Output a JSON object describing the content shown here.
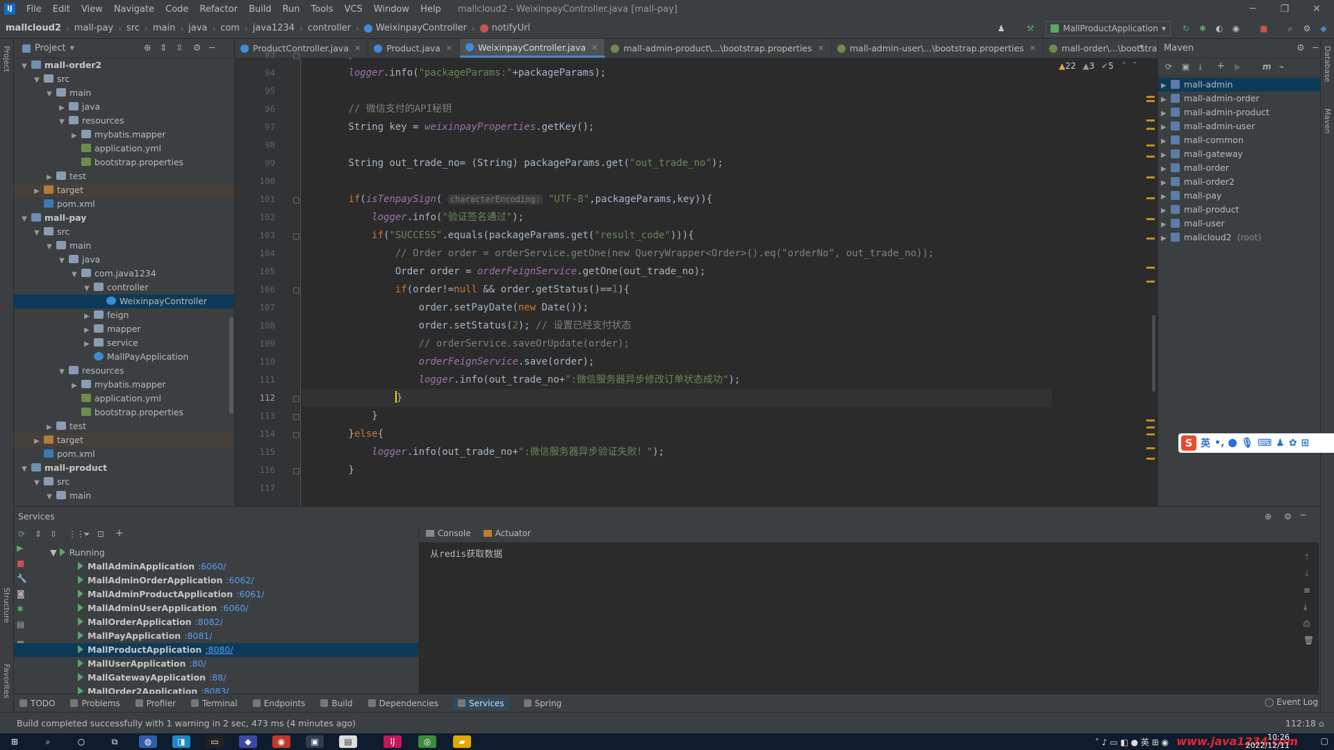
{
  "window": {
    "title": "mallcloud2 - WeixinpayController.java [mall-pay]",
    "menu": [
      "File",
      "Edit",
      "View",
      "Navigate",
      "Code",
      "Refactor",
      "Build",
      "Run",
      "Tools",
      "VCS",
      "Window",
      "Help"
    ]
  },
  "breadcrumb": [
    "mallcloud2",
    "mall-pay",
    "src",
    "main",
    "java",
    "com",
    "java1234",
    "controller",
    "WeixinpayController",
    "notifyUrl"
  ],
  "run_config": "MallProductApplication",
  "project_panel": {
    "title": "Project",
    "tree": [
      {
        "label": "mall-order2",
        "depth": 1,
        "arrow": "down",
        "icon": "module",
        "bold": true
      },
      {
        "label": "src",
        "depth": 2,
        "arrow": "down",
        "icon": "folder"
      },
      {
        "label": "main",
        "depth": 3,
        "arrow": "down",
        "icon": "folder"
      },
      {
        "label": "java",
        "depth": 4,
        "arrow": "right",
        "icon": "folder"
      },
      {
        "label": "resources",
        "depth": 4,
        "arrow": "down",
        "icon": "folder"
      },
      {
        "label": "mybatis.mapper",
        "depth": 5,
        "arrow": "right",
        "icon": "folder"
      },
      {
        "label": "application.yml",
        "depth": 5,
        "arrow": "",
        "icon": "file"
      },
      {
        "label": "bootstrap.properties",
        "depth": 5,
        "arrow": "",
        "icon": "file"
      },
      {
        "label": "test",
        "depth": 3,
        "arrow": "right",
        "icon": "folder"
      },
      {
        "label": "target",
        "depth": 2,
        "arrow": "right",
        "icon": "target",
        "target": true
      },
      {
        "label": "pom.xml",
        "depth": 2,
        "arrow": "",
        "icon": "xml"
      },
      {
        "label": "mall-pay",
        "depth": 1,
        "arrow": "down",
        "icon": "module",
        "bold": true
      },
      {
        "label": "src",
        "depth": 2,
        "arrow": "down",
        "icon": "folder"
      },
      {
        "label": "main",
        "depth": 3,
        "arrow": "down",
        "icon": "folder"
      },
      {
        "label": "java",
        "depth": 4,
        "arrow": "down",
        "icon": "folder"
      },
      {
        "label": "com.java1234",
        "depth": 5,
        "arrow": "down",
        "icon": "folder"
      },
      {
        "label": "controller",
        "depth": 6,
        "arrow": "down",
        "icon": "folder"
      },
      {
        "label": "WeixinpayController",
        "depth": 7,
        "arrow": "",
        "icon": "cls",
        "selected": true
      },
      {
        "label": "feign",
        "depth": 6,
        "arrow": "right",
        "icon": "folder"
      },
      {
        "label": "mapper",
        "depth": 6,
        "arrow": "right",
        "icon": "folder"
      },
      {
        "label": "service",
        "depth": 6,
        "arrow": "right",
        "icon": "folder"
      },
      {
        "label": "MallPayApplication",
        "depth": 6,
        "arrow": "",
        "icon": "app"
      },
      {
        "label": "resources",
        "depth": 4,
        "arrow": "down",
        "icon": "folder"
      },
      {
        "label": "mybatis.mapper",
        "depth": 5,
        "arrow": "right",
        "icon": "folder"
      },
      {
        "label": "application.yml",
        "depth": 5,
        "arrow": "",
        "icon": "file"
      },
      {
        "label": "bootstrap.properties",
        "depth": 5,
        "arrow": "",
        "icon": "file"
      },
      {
        "label": "test",
        "depth": 3,
        "arrow": "right",
        "icon": "folder"
      },
      {
        "label": "target",
        "depth": 2,
        "arrow": "right",
        "icon": "target",
        "target": true
      },
      {
        "label": "pom.xml",
        "depth": 2,
        "arrow": "",
        "icon": "xml"
      },
      {
        "label": "mall-product",
        "depth": 1,
        "arrow": "down",
        "icon": "module",
        "bold": true
      },
      {
        "label": "src",
        "depth": 2,
        "arrow": "down",
        "icon": "folder"
      },
      {
        "label": "main",
        "depth": 3,
        "arrow": "down",
        "icon": "folder"
      }
    ]
  },
  "editor_tabs": [
    {
      "label": "ProductController.java",
      "active": false,
      "color": "#3f8bd6"
    },
    {
      "label": "Product.java",
      "active": false,
      "color": "#3f8bd6"
    },
    {
      "label": "WeixinpayController.java",
      "active": true,
      "color": "#3f8bd6"
    },
    {
      "label": "mall-admin-product\\...\\bootstrap.properties",
      "active": false,
      "color": "#6e8c4a"
    },
    {
      "label": "mall-admin-user\\...\\bootstrap.properties",
      "active": false,
      "color": "#6e8c4a"
    },
    {
      "label": "mall-order\\...\\bootstrap.prop",
      "active": false,
      "color": "#6e8c4a"
    }
  ],
  "inspections": {
    "warnings": "22",
    "weak": "3",
    "ok": "5"
  },
  "code": {
    "current_line": "112",
    "lines": [
      {
        "n": "93",
        "html": "        }"
      },
      {
        "n": "94",
        "html": "        <span class=\"fn\">logger</span>.info(<span class=\"st\">\"packageParams:\"</span>+packageParams);"
      },
      {
        "n": "95",
        "html": ""
      },
      {
        "n": "96",
        "html": "        <span class=\"cm\">// 微信支付的API秘钥</span>"
      },
      {
        "n": "97",
        "html": "        String key = <span class=\"fn\">weixinpayProperties</span>.getKey();"
      },
      {
        "n": "98",
        "html": ""
      },
      {
        "n": "99",
        "html": "        String out_trade_no= (String) packageParams.get(<span class=\"st\">\"out_trade_no\"</span>);"
      },
      {
        "n": "100",
        "html": ""
      },
      {
        "n": "101",
        "html": "        <span class=\"kw\">if</span>(<span class=\"fn\">isTenpaySign</span>( <span class=\"hint\">characterEncoding:</span> <span class=\"st\">\"UTF-8\"</span>,packageParams,key)){"
      },
      {
        "n": "102",
        "html": "            <span class=\"fn\">logger</span>.info(<span class=\"st\">\"验证签名通过\"</span>);"
      },
      {
        "n": "103",
        "html": "            <span class=\"kw\">if</span>(<span class=\"st\">\"SUCCESS\"</span>.equals(packageParams.get(<span class=\"st\">\"result_code\"</span>))){"
      },
      {
        "n": "104",
        "html": "                <span class=\"cm\">// Order order = orderService.getOne(new QueryWrapper&lt;Order&gt;().eq(\"orderNo\", out_trade_no));</span>"
      },
      {
        "n": "105",
        "html": "                Order order = <span class=\"fn\">orderFeignService</span>.getOne(out_trade_no);"
      },
      {
        "n": "106",
        "html": "                <span class=\"kw\">if</span>(order!=<span class=\"kw\">null</span> &amp;&amp; order.getStatus()==<span class=\"st\">1</span>){"
      },
      {
        "n": "107",
        "html": "                    order.setPayDate(<span class=\"kw\">new</span> Date());"
      },
      {
        "n": "108",
        "html": "                    order.setStatus(<span class=\"st\">2</span>); <span class=\"cm\">// 设置已经支付状态</span>"
      },
      {
        "n": "109",
        "html": "                    <span class=\"cm\">// orderService.saveOrUpdate(order);</span>"
      },
      {
        "n": "110",
        "html": "                    <span class=\"fn\">orderFeignService</span>.save(order);"
      },
      {
        "n": "111",
        "html": "                    <span class=\"fn\">logger</span>.info(out_trade_no+<span class=\"st\">\":微信服务器异步修改订单状态成功\"</span>);"
      },
      {
        "n": "112",
        "html": "                <span class=\"caret\"></span>}"
      },
      {
        "n": "113",
        "html": "            }"
      },
      {
        "n": "114",
        "html": "        }<span class=\"kw\">else</span>{"
      },
      {
        "n": "115",
        "html": "            <span class=\"fn\">logger</span>.info(out_trade_no+<span class=\"st\">\":微信服务器异步验证失败！\"</span>);"
      },
      {
        "n": "116",
        "html": "        }"
      },
      {
        "n": "117",
        "html": ""
      }
    ]
  },
  "maven": {
    "title": "Maven",
    "items": [
      {
        "label": "mall-admin",
        "selected": true
      },
      {
        "label": "mall-admin-order"
      },
      {
        "label": "mall-admin-product"
      },
      {
        "label": "mall-admin-user"
      },
      {
        "label": "mall-common"
      },
      {
        "label": "mall-gateway"
      },
      {
        "label": "mall-order"
      },
      {
        "label": "mall-order2"
      },
      {
        "label": "mall-pay"
      },
      {
        "label": "mall-product"
      },
      {
        "label": "mall-user"
      },
      {
        "label": "mallcloud2",
        "suffix": "(root)"
      }
    ]
  },
  "services": {
    "title": "Services",
    "group": "Running",
    "apps": [
      {
        "name": "MallAdminApplication",
        "port": ":6060/"
      },
      {
        "name": "MallAdminOrderApplication",
        "port": ":6062/"
      },
      {
        "name": "MallAdminProductApplication",
        "port": ":6061/"
      },
      {
        "name": "MallAdminUserApplication",
        "port": ":6060/"
      },
      {
        "name": "MallOrderApplication",
        "port": ":8082/"
      },
      {
        "name": "MallPayApplication",
        "port": ":8081/"
      },
      {
        "name": "MallProductApplication",
        "port": ":8080/",
        "selected": true
      },
      {
        "name": "MallUserApplication",
        "port": ":80/"
      },
      {
        "name": "MallGatewayApplication",
        "port": ":88/"
      },
      {
        "name": "MallOrder2Application",
        "port": ":8083/"
      }
    ],
    "console_tabs": [
      "Console",
      "Actuator"
    ],
    "console_output": "从redis获取数据"
  },
  "toolwindows": [
    "TODO",
    "Problems",
    "Profiler",
    "Terminal",
    "Endpoints",
    "Build",
    "Dependencies",
    "Services",
    "Spring"
  ],
  "active_toolwindow": "Services",
  "event_log": "Event Log",
  "status": {
    "message": "Build completed successfully with 1 warning in 2 sec, 473 ms (4 minutes ago)",
    "position": "112:18"
  },
  "ime": {
    "lang": "英"
  },
  "taskbar": {
    "time": "10:26",
    "date": "2022/12/11",
    "watermark": "www.java1234.com"
  },
  "side_labels": {
    "project": "Project",
    "structure": "Structure",
    "favorites": "Favorites",
    "database": "Database",
    "maven": "Maven"
  }
}
